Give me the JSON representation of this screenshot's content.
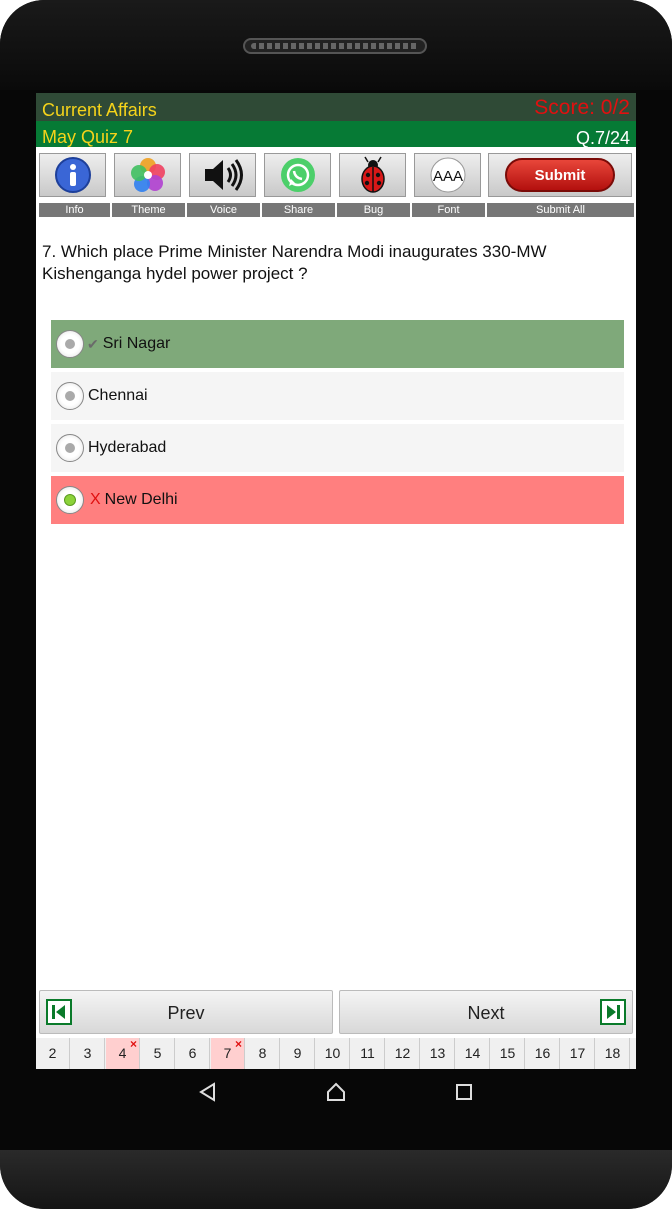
{
  "app": {
    "title": "Current Affairs",
    "score": "Score: 0/2",
    "quiz_name": "May Quiz 7",
    "question_counter": "Q.7/24"
  },
  "toolbar": {
    "items": [
      {
        "label": "Info",
        "icon": "info-icon"
      },
      {
        "label": "Theme",
        "icon": "theme-icon"
      },
      {
        "label": "Voice",
        "icon": "speaker-icon"
      },
      {
        "label": "Share",
        "icon": "whatsapp-icon"
      },
      {
        "label": "Bug",
        "icon": "ladybug-icon"
      },
      {
        "label": "Font",
        "icon": "font-size-icon"
      }
    ],
    "font_icon_text": "AAA",
    "submit_button": "Submit",
    "submit_all_label": "Submit All"
  },
  "question": {
    "text": "7. Which place Prime Minister Narendra Modi inaugurates 330-MW Kishenganga hydel power project ?",
    "options": [
      {
        "text": "Sri Nagar",
        "mark": "✔",
        "state": "correct",
        "selected": false
      },
      {
        "text": "Chennai",
        "mark": "",
        "state": "normal",
        "selected": false
      },
      {
        "text": "Hyderabad",
        "mark": "",
        "state": "normal",
        "selected": false
      },
      {
        "text": "New Delhi",
        "mark": "X",
        "state": "wrong",
        "selected": true
      }
    ]
  },
  "navigation": {
    "prev_label": "Prev",
    "next_label": "Next"
  },
  "question_strip": [
    {
      "n": "2",
      "wrong": false
    },
    {
      "n": "3",
      "wrong": false
    },
    {
      "n": "4",
      "wrong": true
    },
    {
      "n": "5",
      "wrong": false
    },
    {
      "n": "6",
      "wrong": false
    },
    {
      "n": "7",
      "wrong": true
    },
    {
      "n": "8",
      "wrong": false
    },
    {
      "n": "9",
      "wrong": false
    },
    {
      "n": "10",
      "wrong": false
    },
    {
      "n": "11",
      "wrong": false
    },
    {
      "n": "12",
      "wrong": false
    },
    {
      "n": "13",
      "wrong": false
    },
    {
      "n": "14",
      "wrong": false
    },
    {
      "n": "15",
      "wrong": false
    },
    {
      "n": "16",
      "wrong": false
    },
    {
      "n": "17",
      "wrong": false
    },
    {
      "n": "18",
      "wrong": false
    }
  ],
  "wrong_mark": "×",
  "colors": {
    "title_bar": "#2f4a36",
    "sub_bar": "#067a35",
    "title_text": "#f5d31a",
    "score_text": "#e01010",
    "correct_option_bg": "#7fa97a",
    "wrong_option_bg": "#ff7f7f",
    "neutral_option_bg": "#f5f5f5"
  }
}
